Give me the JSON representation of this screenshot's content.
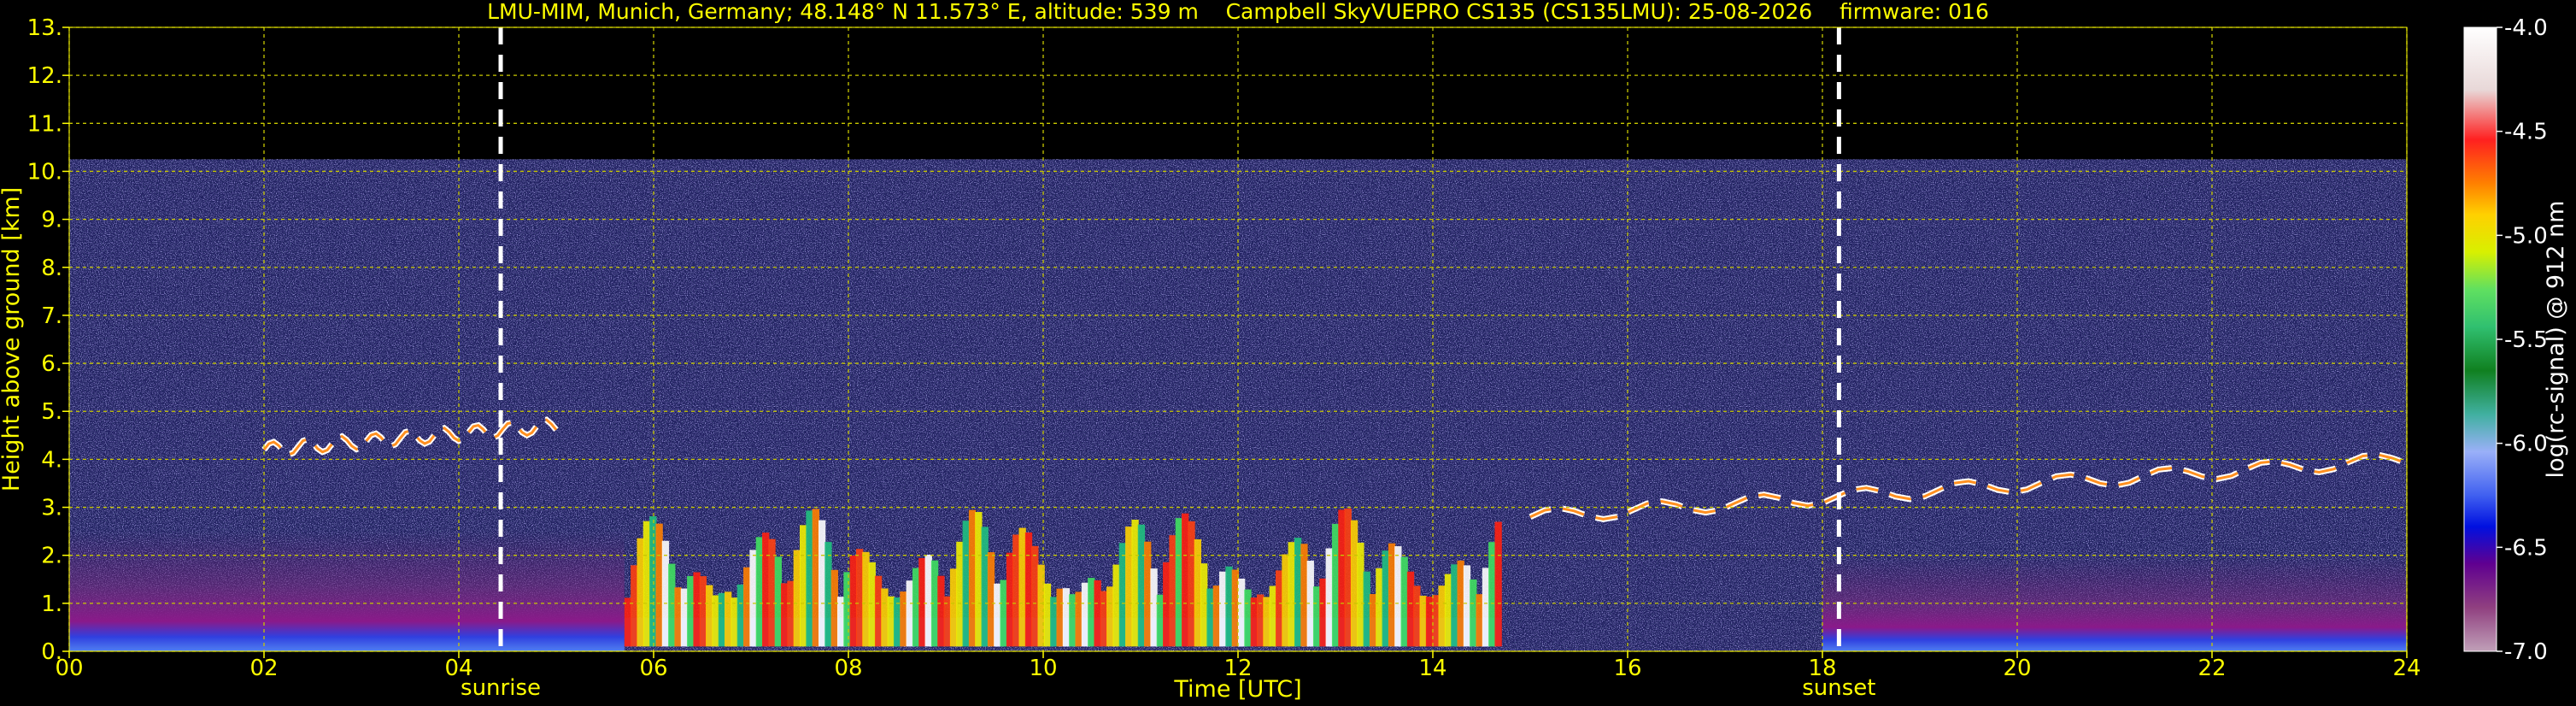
{
  "chart_data": {
    "type": "heatmap",
    "title": "LMU-MIM, Munich, Germany; 48.148° N 11.573° E, altitude: 539 m    Campbell SkyVUEPRO CS135 (CS135LMU): 25-08-2026    firmware: 016",
    "xlabel": "Time [UTC]",
    "ylabel": "Height above ground [km]",
    "xlim": [
      0,
      24
    ],
    "ylim": [
      0,
      13
    ],
    "x_ticks": [
      "00",
      "02",
      "04",
      "06",
      "08",
      "10",
      "12",
      "14",
      "16",
      "18",
      "20",
      "22",
      "24"
    ],
    "x_tick_values": [
      0,
      2,
      4,
      6,
      8,
      10,
      12,
      14,
      16,
      18,
      20,
      22,
      24
    ],
    "y_ticks": [
      "0.",
      "1.",
      "2.",
      "3.",
      "4.",
      "5.",
      "6.",
      "7.",
      "8.",
      "9.",
      "10.",
      "11.",
      "12.",
      "13."
    ],
    "y_tick_values": [
      0,
      1,
      2,
      3,
      4,
      5,
      6,
      7,
      8,
      9,
      10,
      11,
      12,
      13
    ],
    "grid": true,
    "markers": [
      {
        "label": "sunrise",
        "x": 4.43
      },
      {
        "label": "sunset",
        "x": 18.17
      }
    ],
    "colorbar": {
      "label": "log(rc-signal) @ 912 nm",
      "range": [
        -7.0,
        -4.0
      ],
      "ticks": [
        "-4.0",
        "-4.5",
        "-5.0",
        "-5.5",
        "-6.0",
        "-6.5",
        "-7.0"
      ],
      "tick_values": [
        -4.0,
        -4.5,
        -5.0,
        -5.5,
        -6.0,
        -6.5,
        -7.0
      ]
    },
    "features": [
      {
        "name": "noise-region",
        "x": [
          0,
          24
        ],
        "y": [
          0,
          10.25
        ]
      },
      {
        "name": "boundary-layer-night",
        "x": [
          0,
          5.7
        ],
        "y": [
          0,
          2.5
        ]
      },
      {
        "name": "boundary-layer-evening",
        "x": [
          18.0,
          24
        ],
        "y": [
          0,
          2.0
        ]
      },
      {
        "name": "convective-plumes",
        "x": [
          5.7,
          14.7
        ],
        "y": [
          0.1,
          3.0
        ]
      },
      {
        "name": "cloud-layer-morning",
        "x": [
          2.0,
          5.0
        ],
        "y": [
          4.2,
          4.7
        ]
      },
      {
        "name": "cloud-layer-evening",
        "x": [
          15.0,
          24
        ],
        "y": [
          2.8,
          4.0
        ]
      }
    ]
  },
  "colors": {
    "background": "#000000",
    "text": "#ffff00",
    "grid": "#c8c800",
    "marker": "#ffffff"
  }
}
